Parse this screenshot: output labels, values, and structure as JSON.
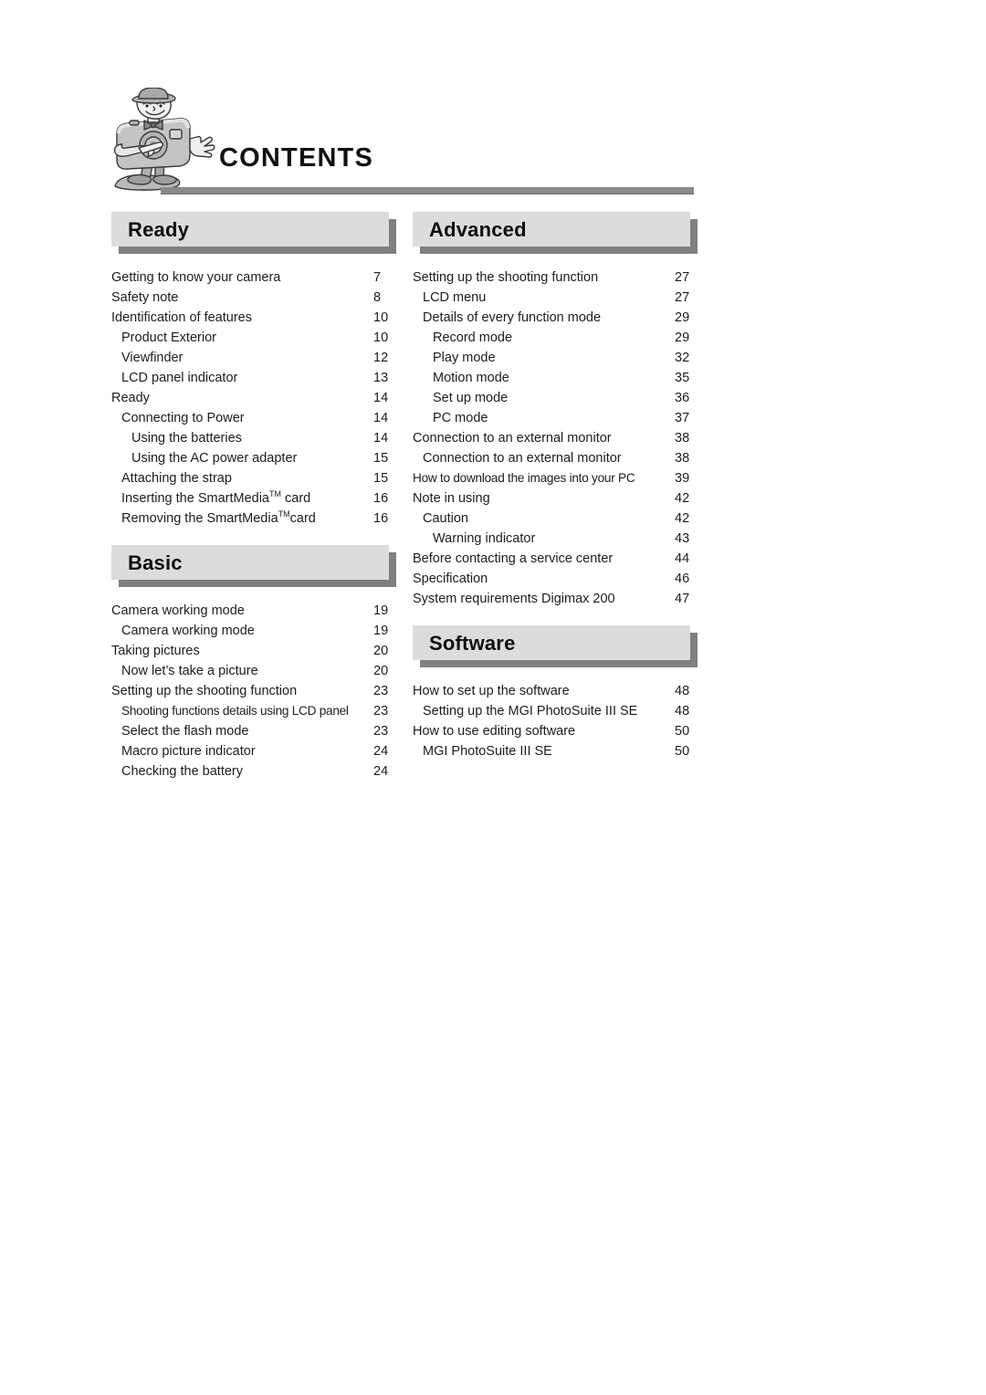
{
  "page": {
    "title": "CONTENTS",
    "mascot_icon": "camera-mascot-illustration"
  },
  "columns": {
    "left": [
      {
        "id": "ready",
        "heading": "Ready",
        "entries": [
          {
            "title": "Getting to know your camera",
            "page": "7",
            "level": 0
          },
          {
            "title": "Safety note",
            "page": "8",
            "level": 0
          },
          {
            "title": "Identification of features",
            "page": "10",
            "level": 0
          },
          {
            "title": "Product Exterior",
            "page": "10",
            "level": 1
          },
          {
            "title": "Viewfinder",
            "page": "12",
            "level": 1
          },
          {
            "title": "LCD panel indicator",
            "page": "13",
            "level": 1
          },
          {
            "title": "Ready",
            "page": "14",
            "level": 0
          },
          {
            "title": "Connecting to Power",
            "page": "14",
            "level": 1
          },
          {
            "title": "Using the batteries",
            "page": "14",
            "level": 2
          },
          {
            "title": "Using the AC power adapter",
            "page": "15",
            "level": 2
          },
          {
            "title": "Attaching the strap",
            "page": "15",
            "level": 1
          },
          {
            "title": "Inserting the SmartMedia™ card",
            "page": "16",
            "level": 1
          },
          {
            "title": "Removing the SmartMedia™card",
            "page": "16",
            "level": 1
          }
        ]
      },
      {
        "id": "basic",
        "heading": "Basic",
        "entries": [
          {
            "title": "Camera working mode",
            "page": "19",
            "level": 0
          },
          {
            "title": "Camera working mode",
            "page": "19",
            "level": 1
          },
          {
            "title": "Taking pictures",
            "page": "20",
            "level": 0
          },
          {
            "title": "Now let’s take a picture",
            "page": "20",
            "level": 1
          },
          {
            "title": "Setting up the shooting function",
            "page": "23",
            "level": 0
          },
          {
            "title": "Shooting functions details using LCD panel",
            "page": "23",
            "level": 1,
            "condensed": true
          },
          {
            "title": "Select the flash mode",
            "page": "23",
            "level": 1
          },
          {
            "title": "Macro picture indicator",
            "page": "24",
            "level": 1
          },
          {
            "title": "Checking the battery",
            "page": "24",
            "level": 1
          }
        ]
      }
    ],
    "right": [
      {
        "id": "advanced",
        "heading": "Advanced",
        "entries": [
          {
            "title": "Setting up the shooting function",
            "page": "27",
            "level": 0
          },
          {
            "title": "LCD menu",
            "page": "27",
            "level": 1
          },
          {
            "title": "Details of every function mode",
            "page": "29",
            "level": 1
          },
          {
            "title": "Record mode",
            "page": "29",
            "level": 2
          },
          {
            "title": "Play mode",
            "page": "32",
            "level": 2
          },
          {
            "title": "Motion mode",
            "page": "35",
            "level": 2
          },
          {
            "title": "Set up mode",
            "page": "36",
            "level": 2
          },
          {
            "title": "PC mode",
            "page": "37",
            "level": 2
          },
          {
            "title": "Connection to an external monitor",
            "page": "38",
            "level": 0
          },
          {
            "title": "Connection to an external monitor",
            "page": "38",
            "level": 1
          },
          {
            "title": "How to download the images into your PC",
            "page": "39",
            "level": 0,
            "condensed": true
          },
          {
            "title": "Note in using",
            "page": "42",
            "level": 0
          },
          {
            "title": "Caution",
            "page": "42",
            "level": 1
          },
          {
            "title": "Warning indicator",
            "page": "43",
            "level": 2
          },
          {
            "title": "Before contacting a service center",
            "page": "44",
            "level": 0
          },
          {
            "title": "Specification",
            "page": "46",
            "level": 0
          },
          {
            "title": "System requirements Digimax 200",
            "page": "47",
            "level": 0
          }
        ]
      },
      {
        "id": "software",
        "heading": "Software",
        "entries": [
          {
            "title": "How to set up the software",
            "page": "48",
            "level": 0
          },
          {
            "title": "Setting up the MGI PhotoSuite III SE",
            "page": "48",
            "level": 1
          },
          {
            "title": "How to use editing software",
            "page": "50",
            "level": 0
          },
          {
            "title": "MGI PhotoSuite III SE",
            "page": "50",
            "level": 1
          }
        ]
      }
    ]
  },
  "layout": {
    "section_tops": {
      "ready": 232,
      "basic": 597,
      "advanced": 232,
      "software": 685
    }
  },
  "colors": {
    "banner_face": "#dcdcdc",
    "banner_shadow": "#808080",
    "rule": "#8a8a8a",
    "text": "#1d1d1d",
    "heading_text": "#0f0f0f"
  }
}
